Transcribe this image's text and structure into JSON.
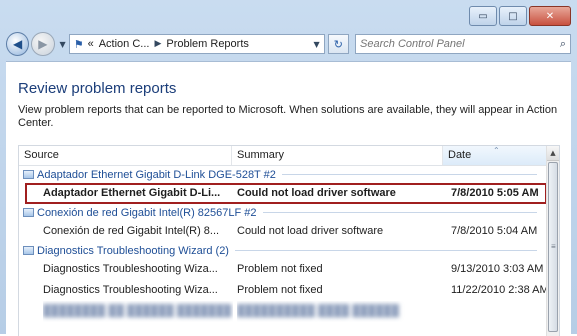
{
  "window": {
    "buttons": {
      "minimize": "▭",
      "maximize": "□",
      "close": "✕"
    }
  },
  "nav": {
    "back_icon": "back-arrow-icon",
    "forward_icon": "forward-arrow-icon",
    "address": {
      "crumbs": [
        "Action C...",
        "Problem Reports"
      ],
      "prefix": "«"
    },
    "search_placeholder": "Search Control Panel"
  },
  "page": {
    "title": "Review problem reports",
    "description": "View problem reports that can be reported to Microsoft. When solutions are available, they will appear in Action Center."
  },
  "list": {
    "columns": {
      "source": "Source",
      "summary": "Summary",
      "date": "Date"
    },
    "groups": [
      {
        "name": "Adaptador Ethernet Gigabit D-Link DGE-528T #2",
        "rows": [
          {
            "source": "Adaptador Ethernet Gigabit D-Li...",
            "summary": "Could not load driver software",
            "date": "7/8/2010 5:05 AM",
            "selected": true
          }
        ]
      },
      {
        "name": "Conexión de red Gigabit Intel(R) 82567LF #2",
        "rows": [
          {
            "source": "Conexión de red Gigabit Intel(R) 8...",
            "summary": "Could not load driver software",
            "date": "7/8/2010 5:04 AM"
          }
        ]
      },
      {
        "name": "Diagnostics Troubleshooting Wizard (2)",
        "rows": [
          {
            "source": "Diagnostics Troubleshooting Wiza...",
            "summary": "Problem not fixed",
            "date": "9/13/2010 3:03 AM"
          },
          {
            "source": "Diagnostics Troubleshooting Wiza...",
            "summary": "Problem not fixed",
            "date": "11/22/2010 2:38 AM"
          }
        ]
      }
    ]
  },
  "colors": {
    "title": "#1c3e7a",
    "group_text": "#1e4e96",
    "selection_outline": "#a01f1f"
  }
}
